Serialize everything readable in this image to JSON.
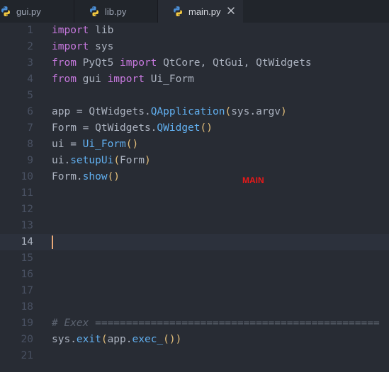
{
  "tabs": [
    {
      "label": "gui.py",
      "icon": "python-file-icon"
    },
    {
      "label": "lib.py",
      "icon": "python-file-icon"
    },
    {
      "label": "main.py",
      "icon": "python-file-icon",
      "close_icon": "close-icon",
      "active": true
    }
  ],
  "editor": {
    "lines": [
      {
        "num": "1",
        "tokens": [
          {
            "t": "import",
            "k": "kw"
          },
          {
            "t": " lib"
          }
        ]
      },
      {
        "num": "2",
        "tokens": [
          {
            "t": "import",
            "k": "kw"
          },
          {
            "t": " sys"
          }
        ]
      },
      {
        "num": "3",
        "tokens": [
          {
            "t": "from",
            "k": "kw"
          },
          {
            "t": " PyQt5 "
          },
          {
            "t": "import",
            "k": "kw"
          },
          {
            "t": " QtCore, QtGui, QtWidgets"
          }
        ]
      },
      {
        "num": "4",
        "tokens": [
          {
            "t": "from",
            "k": "kw"
          },
          {
            "t": " gui "
          },
          {
            "t": "import",
            "k": "kw"
          },
          {
            "t": " Ui_Form"
          }
        ]
      },
      {
        "num": "5",
        "tokens": []
      },
      {
        "num": "6",
        "tokens": [
          {
            "t": "app = QtWidgets."
          },
          {
            "t": "QApplication",
            "k": "fn"
          },
          {
            "t": "(",
            "k": "br"
          },
          {
            "t": "sys.argv"
          },
          {
            "t": ")",
            "k": "br"
          }
        ]
      },
      {
        "num": "7",
        "tokens": [
          {
            "t": "Form = QtWidgets."
          },
          {
            "t": "QWidget",
            "k": "fn"
          },
          {
            "t": "()",
            "k": "br"
          }
        ]
      },
      {
        "num": "8",
        "tokens": [
          {
            "t": "ui = "
          },
          {
            "t": "Ui_Form",
            "k": "fn"
          },
          {
            "t": "()",
            "k": "br"
          }
        ]
      },
      {
        "num": "9",
        "tokens": [
          {
            "t": "ui."
          },
          {
            "t": "setupUi",
            "k": "fn"
          },
          {
            "t": "(",
            "k": "br"
          },
          {
            "t": "Form"
          },
          {
            "t": ")",
            "k": "br"
          }
        ]
      },
      {
        "num": "10",
        "tokens": [
          {
            "t": "Form."
          },
          {
            "t": "show",
            "k": "fn"
          },
          {
            "t": "()",
            "k": "br"
          }
        ]
      },
      {
        "num": "11",
        "tokens": []
      },
      {
        "num": "12",
        "tokens": []
      },
      {
        "num": "13",
        "tokens": []
      },
      {
        "num": "14",
        "tokens": [],
        "current": true
      },
      {
        "num": "15",
        "tokens": []
      },
      {
        "num": "16",
        "tokens": []
      },
      {
        "num": "17",
        "tokens": []
      },
      {
        "num": "18",
        "tokens": []
      },
      {
        "num": "19",
        "tokens": [
          {
            "t": "# Exex ==============================================",
            "k": "cm"
          }
        ]
      },
      {
        "num": "20",
        "tokens": [
          {
            "t": "sys."
          },
          {
            "t": "exit",
            "k": "fn"
          },
          {
            "t": "(",
            "k": "br"
          },
          {
            "t": "app."
          },
          {
            "t": "exec_",
            "k": "fn"
          },
          {
            "t": "()",
            "k": "br"
          },
          {
            "t": ")",
            "k": "br"
          }
        ]
      },
      {
        "num": "21",
        "tokens": []
      }
    ]
  },
  "overlay": {
    "label": "MAIN",
    "color": "#e81919"
  },
  "colors": {
    "background": "#282c34",
    "tabbar": "#21252b",
    "keyword": "#c678dd",
    "function": "#61afef",
    "bracket": "#e5c07b",
    "comment": "#5c6370",
    "text": "#abb2bf",
    "cursor": "#e8a878"
  }
}
